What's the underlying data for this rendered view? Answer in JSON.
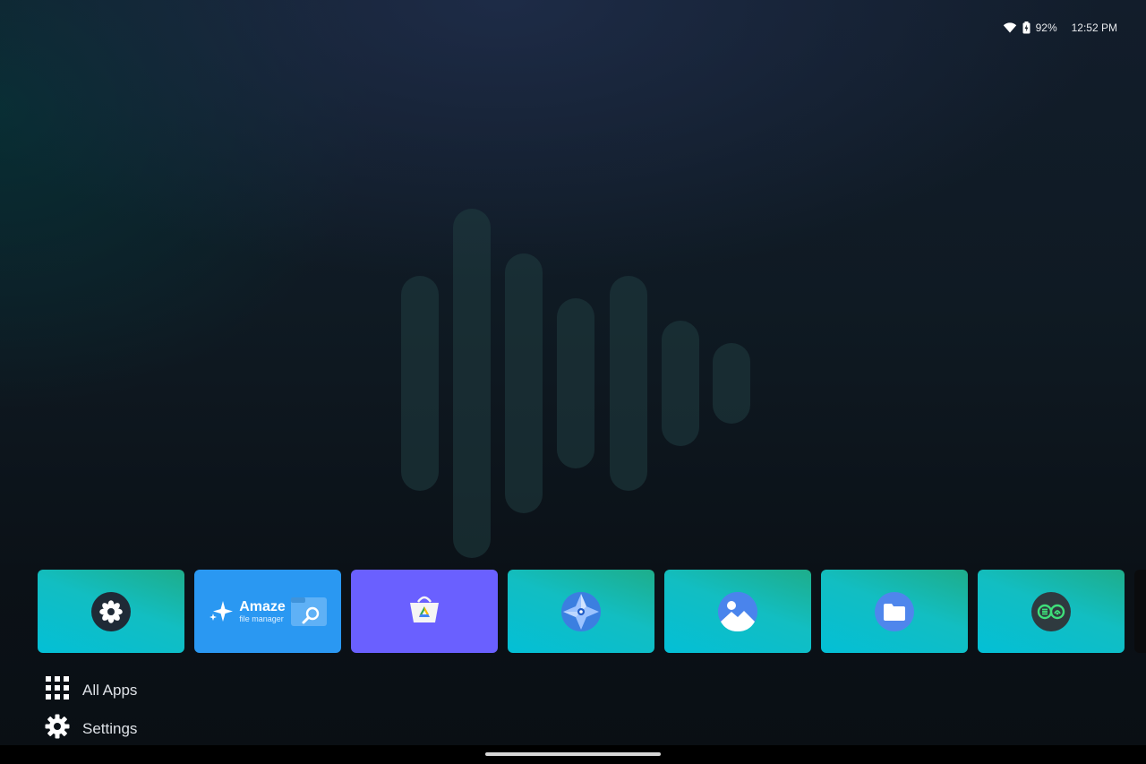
{
  "status_bar": {
    "wifi_icon": "wifi-icon",
    "battery_icon": "battery-charging-icon",
    "battery_percent": "92%",
    "time": "12:52 PM"
  },
  "background_logo": {
    "icon": "audio-bars-logo",
    "bar_color": "#203e42"
  },
  "app_row": {
    "tiles": [
      {
        "name": "app-tile-1",
        "icon": "flower-icon",
        "color": "teal"
      },
      {
        "name": "app-tile-amaze",
        "icon": "amaze-file-manager-banner",
        "title": "Amaze",
        "subtitle": "file manager",
        "color": "#2a98f2"
      },
      {
        "name": "app-tile-store",
        "icon": "store-bag-icon",
        "color": "#6a60ff"
      },
      {
        "name": "app-tile-4",
        "icon": "compass-icon",
        "color": "teal"
      },
      {
        "name": "app-tile-gallery",
        "icon": "gallery-icon",
        "color": "teal"
      },
      {
        "name": "app-tile-files",
        "icon": "folder-icon",
        "color": "teal"
      },
      {
        "name": "app-tile-7",
        "icon": "equalizer-icon",
        "color": "teal"
      },
      {
        "name": "app-tile-partial",
        "icon": "",
        "color": "#0a0b0d"
      }
    ]
  },
  "menu": {
    "all_apps_label": "All Apps",
    "all_apps_icon": "grid-icon",
    "settings_label": "Settings",
    "settings_icon": "gear-icon"
  },
  "colors": {
    "teal_tile_from": "#1ead8a",
    "teal_tile_to": "#03bfd6",
    "blue_tile": "#2a98f2",
    "purple_tile": "#6a60ff"
  }
}
